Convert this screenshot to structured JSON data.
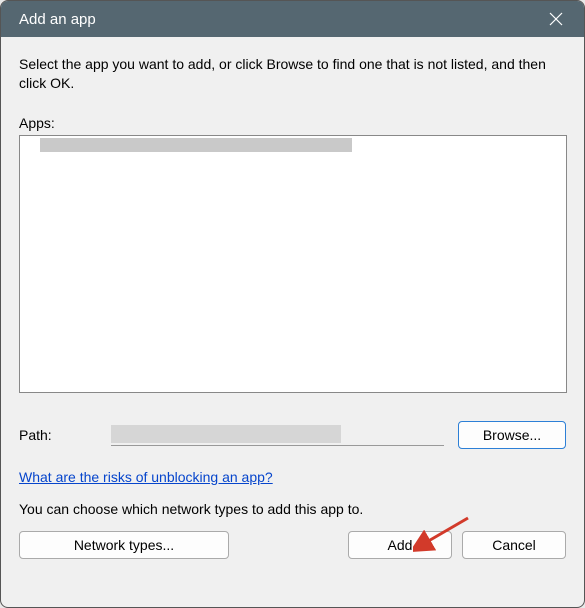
{
  "titlebar": {
    "title": "Add an app"
  },
  "content": {
    "instruction": "Select the app you want to add, or click Browse to find one that is not listed, and then click OK.",
    "apps_label": "Apps:",
    "path_label": "Path:",
    "browse_label": "Browse...",
    "risks_link": "What are the risks of unblocking an app?",
    "network_text": "You can choose which network types to add this app to."
  },
  "buttons": {
    "network_types": "Network types...",
    "add": "Add",
    "cancel": "Cancel"
  }
}
